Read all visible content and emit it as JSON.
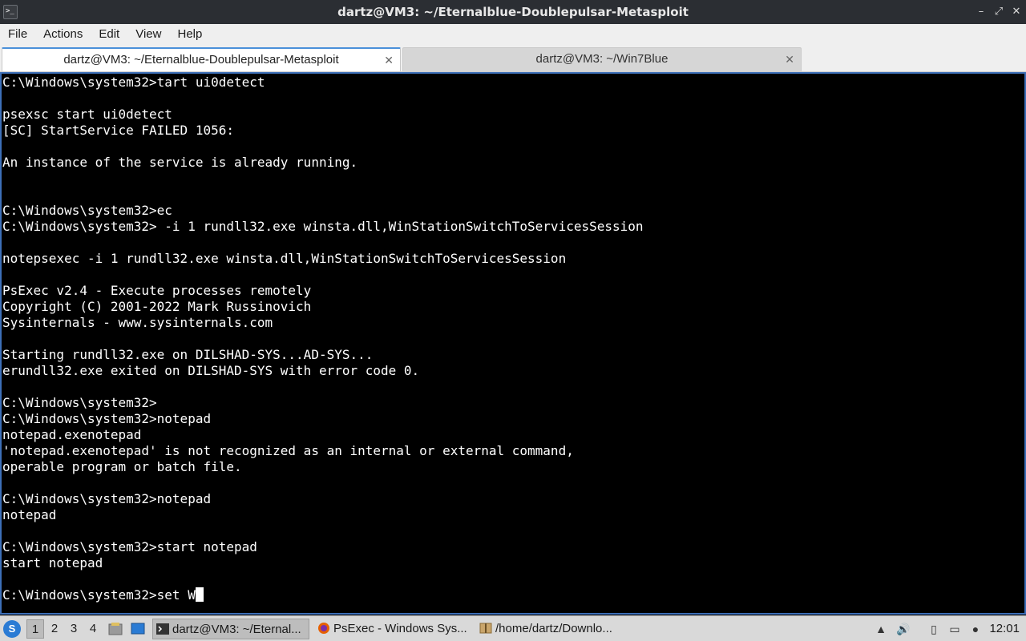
{
  "window": {
    "title": "dartz@VM3: ~/Eternalblue-Doublepulsar-Metasploit",
    "app_icon_glyph": ">_",
    "controls": {
      "minimize": "–",
      "maximize": "⤢",
      "close": "✕"
    }
  },
  "menubar": {
    "items": [
      "File",
      "Actions",
      "Edit",
      "View",
      "Help"
    ]
  },
  "tabs": [
    {
      "label": "dartz@VM3: ~/Eternalblue-Doublepulsar-Metasploit",
      "active": true
    },
    {
      "label": "dartz@VM3: ~/Win7Blue",
      "active": false
    }
  ],
  "terminal": {
    "lines": [
      "C:\\Windows\\system32>tart ui0detect",
      "",
      "psexsc start ui0detect",
      "[SC] StartService FAILED 1056:",
      "",
      "An instance of the service is already running.",
      "",
      "",
      "C:\\Windows\\system32>ec",
      "C:\\Windows\\system32> -i 1 rundll32.exe winsta.dll,WinStationSwitchToServicesSession",
      "",
      "notepsexec -i 1 rundll32.exe winsta.dll,WinStationSwitchToServicesSession",
      "",
      "PsExec v2.4 - Execute processes remotely",
      "Copyright (C) 2001-2022 Mark Russinovich",
      "Sysinternals - www.sysinternals.com",
      "",
      "Starting rundll32.exe on DILSHAD-SYS...AD-SYS...",
      "erundll32.exe exited on DILSHAD-SYS with error code 0.",
      "",
      "C:\\Windows\\system32>",
      "C:\\Windows\\system32>notepad",
      "notepad.exenotepad",
      "'notepad.exenotepad' is not recognized as an internal or external command,",
      "operable program or batch file.",
      "",
      "C:\\Windows\\system32>notepad",
      "notepad",
      "",
      "C:\\Windows\\system32>start notepad",
      "start notepad",
      "",
      "C:\\Windows\\system32>set W"
    ]
  },
  "taskbar": {
    "workspaces": [
      "1",
      "2",
      "3",
      "4"
    ],
    "active_workspace": "1",
    "tasks": [
      {
        "label": "dartz@VM3: ~/Eternal...",
        "icon": "terminal-icon",
        "active": true
      },
      {
        "label": "PsExec - Windows Sys...",
        "icon": "firefox-icon",
        "active": false
      },
      {
        "label": "/home/dartz/Downlo...",
        "icon": "archive-icon",
        "active": false
      }
    ],
    "clock": "12:01"
  },
  "colors": {
    "titlebar_bg": "#2b2e33",
    "terminal_bg": "#000000",
    "terminal_fg": "#ffffff",
    "focus_border": "#3d6fb8",
    "taskbar_bg": "#d9d9d9"
  }
}
